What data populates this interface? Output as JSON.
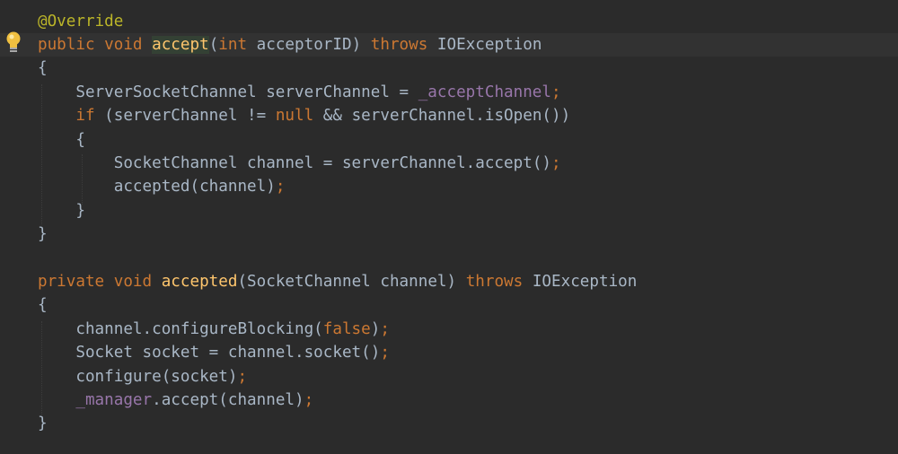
{
  "editor": {
    "colors": {
      "background": "#2b2b2b",
      "current_line": "#323232",
      "keyword": "#cc7832",
      "annotation": "#bbb529",
      "function": "#ffc66d",
      "field": "#9876aa",
      "text": "#a9b7c6",
      "usage_highlight": "#344134"
    },
    "gutter": {
      "intention_icon": "lightbulb-icon"
    },
    "lines": [
      {
        "tokens": [
          {
            "t": "ann",
            "v": "@Override"
          }
        ]
      },
      {
        "current": true,
        "tokens": [
          {
            "t": "kw",
            "v": "public"
          },
          {
            "t": "plain",
            "v": " "
          },
          {
            "t": "kw",
            "v": "void"
          },
          {
            "t": "plain",
            "v": " "
          },
          {
            "t": "fn",
            "v": "accept",
            "hl": true
          },
          {
            "t": "plain",
            "v": "("
          },
          {
            "t": "kw",
            "v": "int"
          },
          {
            "t": "plain",
            "v": " acceptorID) "
          },
          {
            "t": "kw",
            "v": "throws"
          },
          {
            "t": "plain",
            "v": " IOException"
          }
        ]
      },
      {
        "tokens": [
          {
            "t": "plain",
            "v": "{"
          }
        ]
      },
      {
        "tokens": [
          {
            "t": "plain",
            "v": "    ServerSocketChannel serverChannel = "
          },
          {
            "t": "field",
            "v": "_acceptChannel"
          },
          {
            "t": "punct",
            "v": ";"
          }
        ]
      },
      {
        "tokens": [
          {
            "t": "plain",
            "v": "    "
          },
          {
            "t": "kw",
            "v": "if"
          },
          {
            "t": "plain",
            "v": " (serverChannel != "
          },
          {
            "t": "kw",
            "v": "null"
          },
          {
            "t": "plain",
            "v": " && serverChannel.isOpen())"
          }
        ]
      },
      {
        "tokens": [
          {
            "t": "plain",
            "v": "    {"
          }
        ]
      },
      {
        "tokens": [
          {
            "t": "plain",
            "v": "        SocketChannel channel = serverChannel."
          },
          {
            "t": "plain",
            "v": "accept"
          },
          {
            "t": "plain",
            "v": "()"
          },
          {
            "t": "punct",
            "v": ";"
          }
        ]
      },
      {
        "tokens": [
          {
            "t": "plain",
            "v": "        accepted(channel)"
          },
          {
            "t": "punct",
            "v": ";"
          }
        ]
      },
      {
        "tokens": [
          {
            "t": "plain",
            "v": "    }"
          }
        ]
      },
      {
        "tokens": [
          {
            "t": "plain",
            "v": "}"
          }
        ]
      },
      {
        "tokens": []
      },
      {
        "tokens": [
          {
            "t": "kw",
            "v": "private"
          },
          {
            "t": "plain",
            "v": " "
          },
          {
            "t": "kw",
            "v": "void"
          },
          {
            "t": "plain",
            "v": " "
          },
          {
            "t": "fn",
            "v": "accepted"
          },
          {
            "t": "plain",
            "v": "(SocketChannel channel) "
          },
          {
            "t": "kw",
            "v": "throws"
          },
          {
            "t": "plain",
            "v": " IOException"
          }
        ]
      },
      {
        "tokens": [
          {
            "t": "plain",
            "v": "{"
          }
        ]
      },
      {
        "tokens": [
          {
            "t": "plain",
            "v": "    channel.configureBlocking("
          },
          {
            "t": "kw",
            "v": "false"
          },
          {
            "t": "plain",
            "v": ")"
          },
          {
            "t": "punct",
            "v": ";"
          }
        ]
      },
      {
        "tokens": [
          {
            "t": "plain",
            "v": "    Socket socket = channel.socket()"
          },
          {
            "t": "punct",
            "v": ";"
          }
        ]
      },
      {
        "tokens": [
          {
            "t": "plain",
            "v": "    configure(socket)"
          },
          {
            "t": "punct",
            "v": ";"
          }
        ]
      },
      {
        "tokens": [
          {
            "t": "plain",
            "v": "    "
          },
          {
            "t": "field",
            "v": "_manager"
          },
          {
            "t": "plain",
            "v": ".accept(channel)"
          },
          {
            "t": "punct",
            "v": ";"
          }
        ]
      },
      {
        "tokens": [
          {
            "t": "plain",
            "v": "}"
          }
        ]
      }
    ]
  }
}
